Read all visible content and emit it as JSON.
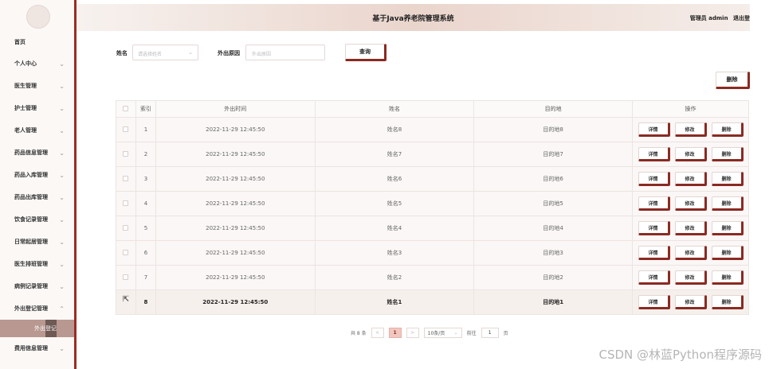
{
  "header": {
    "title": "基于Java养老院管理系统",
    "user_label": "管理员 admin",
    "logout_label": "退出登"
  },
  "sidebar": {
    "home": "首页",
    "items": [
      {
        "label": "个人中心"
      },
      {
        "label": "医生管理"
      },
      {
        "label": "护士管理"
      },
      {
        "label": "老人管理"
      },
      {
        "label": "药品信息管理"
      },
      {
        "label": "药品入库管理"
      },
      {
        "label": "药品出库管理"
      },
      {
        "label": "饮食记录管理"
      },
      {
        "label": "日常起居管理"
      },
      {
        "label": "医生排班管理"
      },
      {
        "label": "病例记录管理"
      },
      {
        "label": "外出登记管理"
      }
    ],
    "active_sub": "外出登记",
    "after_items": [
      {
        "label": "费用信息管理"
      }
    ]
  },
  "search": {
    "name_label": "姓名",
    "name_placeholder": "请选择姓名",
    "reason_label": "外出原因",
    "reason_placeholder": "外出原因",
    "query_button": "查询",
    "delete_button": "删除"
  },
  "table": {
    "headers": [
      "索引",
      "外出时间",
      "姓名",
      "目的地",
      "操作"
    ],
    "rows": [
      {
        "index": "1",
        "time": "2022-11-29 12:45:50",
        "name": "姓名8",
        "dest": "目的地8"
      },
      {
        "index": "2",
        "time": "2022-11-29 12:45:50",
        "name": "姓名7",
        "dest": "目的地7"
      },
      {
        "index": "3",
        "time": "2022-11-29 12:45:50",
        "name": "姓名6",
        "dest": "目的地6"
      },
      {
        "index": "4",
        "time": "2022-11-29 12:45:50",
        "name": "姓名5",
        "dest": "目的地5"
      },
      {
        "index": "5",
        "time": "2022-11-29 12:45:50",
        "name": "姓名4",
        "dest": "目的地4"
      },
      {
        "index": "6",
        "time": "2022-11-29 12:45:50",
        "name": "姓名3",
        "dest": "目的地3"
      },
      {
        "index": "7",
        "time": "2022-11-29 12:45:50",
        "name": "姓名2",
        "dest": "目的地2"
      },
      {
        "index": "8",
        "time": "2022-11-29 12:45:50",
        "name": "姓名1",
        "dest": "目的地1"
      }
    ],
    "actions": {
      "detail": "详情",
      "edit": "修改",
      "delete": "删除"
    }
  },
  "pagination": {
    "total": "共 8 条",
    "prev": "<",
    "current": "1",
    "next": ">",
    "page_size": "10条/页",
    "goto_label": "前往",
    "goto_value": "1",
    "page_unit": "页"
  },
  "watermark": "CSDN @林蓝Python程序源码",
  "colors": {
    "accent": "#8a2a22",
    "header_gradient": "#ead5cc",
    "active_page": "#f1c7c0"
  }
}
